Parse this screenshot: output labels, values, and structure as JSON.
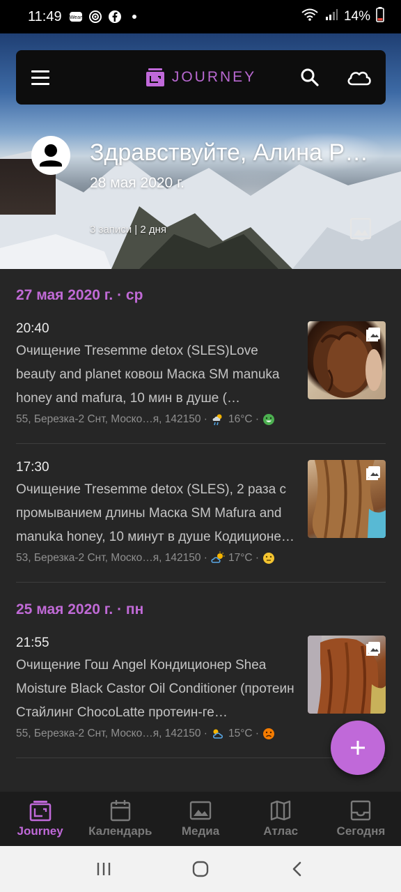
{
  "status_bar": {
    "time": "11:49",
    "battery": "14%",
    "icons": [
      "wear-icon",
      "alarm-icon",
      "facebook-icon",
      "dot-icon",
      "wifi-icon",
      "signal-icon",
      "battery-icon"
    ]
  },
  "app_bar": {
    "brand": "JOURNEY",
    "accent": "#c069d9",
    "icons": [
      "menu-icon",
      "journey-logo-icon",
      "search-icon",
      "cloud-icon"
    ]
  },
  "hero": {
    "greeting": "Здравствуйте, Алина Р…",
    "date": "28 мая 2020 г.",
    "stats": "3 записи | 2 дня"
  },
  "groups": [
    {
      "date": "27 мая 2020 г. · ср",
      "entries": [
        {
          "time": "20:40",
          "text": "Очищение Tresemme detox (SLES)Love beauty and planet ковош Маска SM manuka honey and mafura, 10 мин в душе (…",
          "location": "55, Березка-2 Снт, Моско…я, 142150 ·",
          "weather_icon": "rain-cloud-icon",
          "temp": "16°C ·",
          "mood_icon": "mood-happy-icon",
          "mood_color": "#4caf50"
        },
        {
          "time": "17:30",
          "text": "Очищение Tresemme detox (SLES), 2 раза с промыванием длины Маска SM Mafura and manuka honey, 10 минут в душе Кодиционе…",
          "location": "53, Березка-2 Снт, Моско…я, 142150 ·",
          "weather_icon": "partly-sunny-icon",
          "temp": "17°C ·",
          "mood_icon": "mood-neutral-icon",
          "mood_color": "#f4c430"
        }
      ]
    },
    {
      "date": "25 мая 2020 г. · пн",
      "entries": [
        {
          "time": "21:55",
          "text": "Очищение Гош Angel Кондиционер Shea Moisture Black Castor Oil Conditioner (протеин Стайлинг ChocoLatte протеин-ге…",
          "location": "55, Березка-2 Снт, Моско…я, 142150 ·",
          "weather_icon": "cloud-sun-icon",
          "temp": "15°C ·",
          "mood_icon": "mood-sad-icon",
          "mood_color": "#f57c00"
        }
      ]
    }
  ],
  "bottom_nav": [
    {
      "label": "Journey",
      "icon": "journey-icon",
      "active": true
    },
    {
      "label": "Календарь",
      "icon": "calendar-icon",
      "active": false
    },
    {
      "label": "Медиа",
      "icon": "media-icon",
      "active": false
    },
    {
      "label": "Атлас",
      "icon": "map-icon",
      "active": false
    },
    {
      "label": "Сегодня",
      "icon": "today-icon",
      "active": false
    }
  ]
}
